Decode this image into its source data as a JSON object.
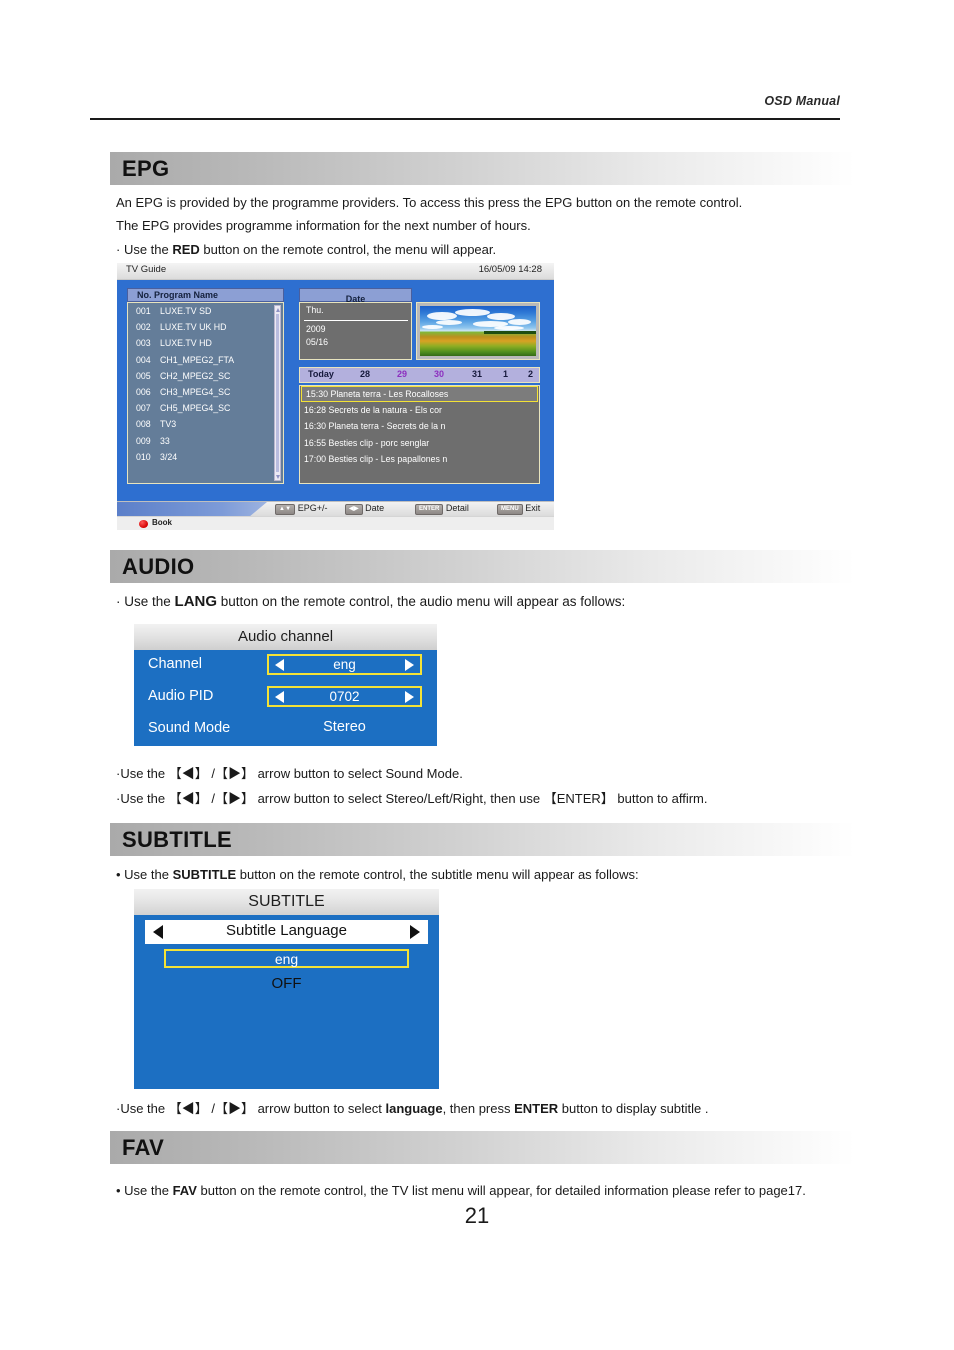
{
  "document": {
    "running_head": "OSD Manual",
    "page_number": "21"
  },
  "sections": {
    "epg": {
      "title": "EPG",
      "paragraphs": [
        "An EPG  is provided by the programme providers. To access this press the EPG button on the remote control.",
        "The EPG provides programme information for the next number of hours."
      ],
      "bullet_prefix": "· Use  the ",
      "bullet_key": "RED",
      "bullet_suffix": " button on the remote control, the menu will appear."
    },
    "audio": {
      "title": "AUDIO",
      "bullet_prefix": "· Use  the ",
      "bullet_key": "LANG",
      "bullet_suffix": " button on the remote control, the audio menu  will appear as follows:",
      "note1_a": "·Use  the  【◀】  /【▶】 arrow  button to select  Sound Mode.",
      "note2_a": "·Use  the  【◀】  /【▶】 arrow  button to select  Stereo/Left/Right, then use 【ENTER】  button to affirm."
    },
    "subtitle": {
      "title": "SUBTITLE",
      "bullet_prefix": "• Use  the  ",
      "bullet_key": "SUBTITLE",
      "bullet_suffix": " button on the remote control, the subtitle menu will appear as follows:",
      "note_prefix": "·Use  the  【◀】  /【▶】 arrow  button to select  ",
      "note_key1": "language",
      "note_mid": ",  then press ",
      "note_key2": "ENTER",
      "note_suffix": " button to display subtitle ."
    },
    "fav": {
      "title": "FAV",
      "bullet_prefix": "• Use  the  ",
      "bullet_key": "FAV",
      "bullet_suffix": " button on the remote control, the TV list menu will appear, for detailed information please refer to page17."
    }
  },
  "epg_osd": {
    "titlebar": {
      "label": "TV Guide",
      "datetime": "16/05/09  14:28"
    },
    "program_panel": {
      "header": "No. Program Name",
      "rows": [
        {
          "no": "001",
          "name": "LUXE.TV SD"
        },
        {
          "no": "002",
          "name": "LUXE.TV UK HD"
        },
        {
          "no": "003",
          "name": "LUXE.TV HD"
        },
        {
          "no": "004",
          "name": "CH1_MPEG2_FTA"
        },
        {
          "no": "005",
          "name": "CH2_MPEG2_SC"
        },
        {
          "no": "006",
          "name": "CH3_MPEG4_SC"
        },
        {
          "no": "007",
          "name": "CH5_MPEG4_SC"
        },
        {
          "no": "008",
          "name": "TV3"
        },
        {
          "no": "009",
          "name": "33"
        },
        {
          "no": "010",
          "name": "3/24"
        }
      ]
    },
    "date_panel": {
      "header": "Date",
      "weekday": "Thu.",
      "year": "2009",
      "monthday": "05/16"
    },
    "date_strip": [
      {
        "label": "Today",
        "highlight": false
      },
      {
        "label": "28",
        "highlight": false
      },
      {
        "label": "29",
        "highlight": true
      },
      {
        "label": "30",
        "highlight": true
      },
      {
        "label": "31",
        "highlight": false
      },
      {
        "label": "1",
        "highlight": false
      },
      {
        "label": "2",
        "highlight": false
      }
    ],
    "events": [
      {
        "time": "15:30",
        "title": "Planeta  terra - Les  Rocalloses",
        "selected": true
      },
      {
        "time": "16:28",
        "title": "Secrets  de la natura - Els cor",
        "selected": false
      },
      {
        "time": "16:30",
        "title": "Planeta  terra - Secrets de la n",
        "selected": false
      },
      {
        "time": "16:55",
        "title": "Besties  clip - porc  senglar",
        "selected": false
      },
      {
        "time": "17:00",
        "title": "Besties  clip - Les papallones n",
        "selected": false
      }
    ],
    "hints": [
      {
        "key": "▲▼",
        "label": "EPG+/-"
      },
      {
        "key": "◀▶",
        "label": "Date"
      },
      {
        "key": "ENTER",
        "label": "Detail"
      },
      {
        "key": "MENU",
        "label": "Exit"
      }
    ],
    "book_label": "Book"
  },
  "audio_osd": {
    "title": "Audio channel",
    "rows": [
      {
        "label": "Channel",
        "value": "eng",
        "type": "spinner"
      },
      {
        "label": "Audio PID",
        "value": "0702",
        "type": "spinner"
      },
      {
        "label": "Sound Mode",
        "value": "Stereo",
        "type": "plain"
      }
    ]
  },
  "subtitle_osd": {
    "title": "SUBTITLE",
    "language_label": "Subtitle Language",
    "selected_option": "eng",
    "other_option": "OFF"
  },
  "colors": {
    "osd_blue": "#1c6fc2",
    "highlight_yellow": "#f3e236",
    "epg_blue": "#2e6fd0",
    "panel_gray": "#6e6e6e",
    "date_purple": "#8c2fbf"
  }
}
